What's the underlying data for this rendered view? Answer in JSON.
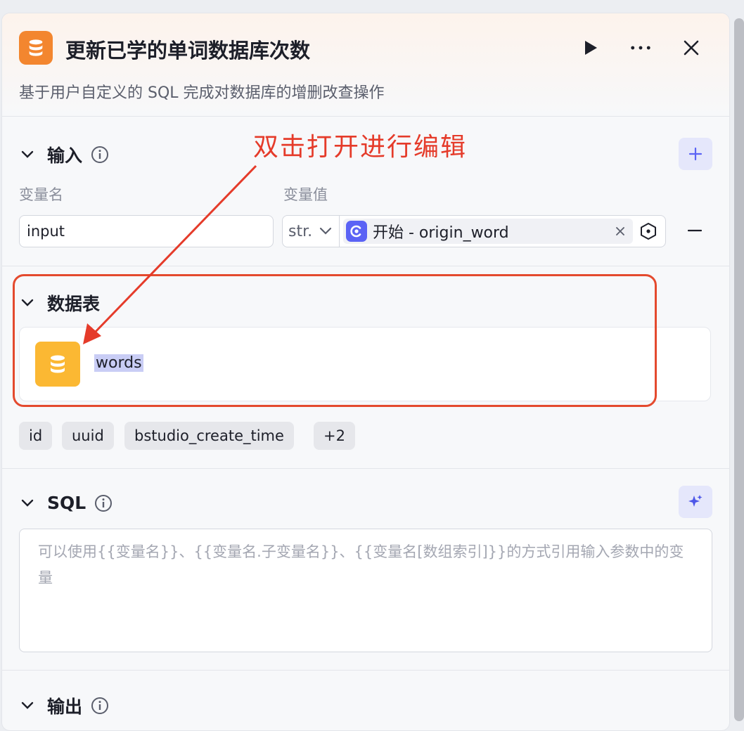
{
  "node": {
    "title": "更新已学的单词数据库次数",
    "description": "基于用户自定义的 SQL 完成对数据库的增删改查操作",
    "icon": "database-icon",
    "accent": "#f3862f"
  },
  "input_section": {
    "title": "输入",
    "col_name_label": "变量名",
    "col_value_label": "变量值",
    "variable_name": "input",
    "type": "str.",
    "reference": "开始 - origin_word"
  },
  "table_section": {
    "title": "数据表",
    "table_name": "words",
    "fields": [
      "id",
      "uuid",
      "bstudio_create_time",
      "+2"
    ]
  },
  "sql_section": {
    "title": "SQL",
    "placeholder": "可以使用{{变量名}}、{{变量名.子变量名}}、{{变量名[数组索引]}}的方式引用输入参数中的变量"
  },
  "output_section": {
    "title": "输出"
  },
  "annotation": {
    "text": "双击打开进行编辑",
    "color": "#e53b2a"
  }
}
